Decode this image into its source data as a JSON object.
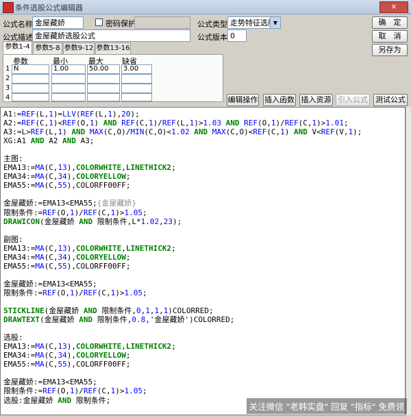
{
  "window": {
    "title": "条件选股公式编辑器",
    "close_label": "×"
  },
  "form": {
    "name_label": "公式名称",
    "name_value": "金屋藏娇",
    "password_label": "密码保护",
    "desc_label": "公式描述",
    "desc_value": "金屋藏娇选股公式",
    "type_label": "公式类型",
    "type_value": "走势特征选股",
    "version_label": "公式版本",
    "version_value": "0"
  },
  "buttons": {
    "ok": "确　定",
    "cancel": "取　消",
    "save_as": "另存为",
    "edit_op": "编辑操作",
    "insert_func": "插入函数",
    "insert_resource": "插入资源",
    "import_formula": "引入公式",
    "test_formula": "测试公式"
  },
  "tabs": [
    "参数1-4",
    "参数5-8",
    "参数9-12",
    "参数13-16"
  ],
  "params": {
    "headers": [
      "参数",
      "最小",
      "最大",
      "缺省"
    ],
    "rows": [
      {
        "num": "1",
        "name": "N",
        "min": "1.00",
        "max": "50.00",
        "default": "3.00"
      },
      {
        "num": "2",
        "name": "",
        "min": "",
        "max": "",
        "default": ""
      },
      {
        "num": "3",
        "name": "",
        "min": "",
        "max": "",
        "default": ""
      },
      {
        "num": "4",
        "name": "",
        "min": "",
        "max": "",
        "default": ""
      }
    ]
  },
  "code_lines": [
    [
      [
        "n",
        "A1:="
      ],
      [
        "f",
        "REF"
      ],
      [
        "n",
        "(L,"
      ],
      [
        "f",
        "1"
      ],
      [
        "n",
        ")="
      ],
      [
        "f",
        "LLV"
      ],
      [
        "n",
        "("
      ],
      [
        "f",
        "REF"
      ],
      [
        "n",
        "(L,"
      ],
      [
        "f",
        "1"
      ],
      [
        "n",
        "),"
      ],
      [
        "f",
        "20"
      ],
      [
        "n",
        ");"
      ]
    ],
    [
      [
        "n",
        "A2:="
      ],
      [
        "f",
        "REF"
      ],
      [
        "n",
        "(C,"
      ],
      [
        "f",
        "1"
      ],
      [
        "n",
        ")<"
      ],
      [
        "f",
        "REF"
      ],
      [
        "n",
        "(O,"
      ],
      [
        "f",
        "1"
      ],
      [
        "n",
        ") "
      ],
      [
        "k",
        "AND"
      ],
      [
        "n",
        " "
      ],
      [
        "f",
        "REF"
      ],
      [
        "n",
        "(C,"
      ],
      [
        "f",
        "1"
      ],
      [
        "n",
        ")/"
      ],
      [
        "f",
        "REF"
      ],
      [
        "n",
        "(L,"
      ],
      [
        "f",
        "1"
      ],
      [
        "n",
        ")>"
      ],
      [
        "f",
        "1.03"
      ],
      [
        "n",
        " "
      ],
      [
        "k",
        "AND"
      ],
      [
        "n",
        " "
      ],
      [
        "f",
        "REF"
      ],
      [
        "n",
        "(O,"
      ],
      [
        "f",
        "1"
      ],
      [
        "n",
        ")/"
      ],
      [
        "f",
        "REF"
      ],
      [
        "n",
        "(C,"
      ],
      [
        "f",
        "1"
      ],
      [
        "n",
        ")>"
      ],
      [
        "f",
        "1.01"
      ],
      [
        "n",
        ";"
      ]
    ],
    [
      [
        "n",
        "A3:=L>"
      ],
      [
        "f",
        "REF"
      ],
      [
        "n",
        "(L,"
      ],
      [
        "f",
        "1"
      ],
      [
        "n",
        ") "
      ],
      [
        "k",
        "AND"
      ],
      [
        "n",
        " "
      ],
      [
        "f",
        "MAX"
      ],
      [
        "n",
        "(C,O)/"
      ],
      [
        "f",
        "MIN"
      ],
      [
        "n",
        "(C,O)<"
      ],
      [
        "f",
        "1.02"
      ],
      [
        "n",
        " "
      ],
      [
        "k",
        "AND"
      ],
      [
        "n",
        " "
      ],
      [
        "f",
        "MAX"
      ],
      [
        "n",
        "(C,O)<"
      ],
      [
        "f",
        "REF"
      ],
      [
        "n",
        "(C,"
      ],
      [
        "f",
        "1"
      ],
      [
        "n",
        ") "
      ],
      [
        "k",
        "AND"
      ],
      [
        "n",
        " V<"
      ],
      [
        "f",
        "REF"
      ],
      [
        "n",
        "(V,"
      ],
      [
        "f",
        "1"
      ],
      [
        "n",
        ");"
      ]
    ],
    [
      [
        "n",
        "XG:A1 "
      ],
      [
        "k",
        "AND"
      ],
      [
        "n",
        " A2 "
      ],
      [
        "k",
        "AND"
      ],
      [
        "n",
        " A3;"
      ]
    ],
    [],
    [
      [
        "n",
        "主图:"
      ]
    ],
    [
      [
        "n",
        "EMA13:="
      ],
      [
        "f",
        "MA"
      ],
      [
        "n",
        "(C,"
      ],
      [
        "f",
        "13"
      ],
      [
        "n",
        "),"
      ],
      [
        "k",
        "COLORWHITE"
      ],
      [
        "n",
        ","
      ],
      [
        "k",
        "LINETHICK2"
      ],
      [
        "n",
        ";"
      ]
    ],
    [
      [
        "n",
        "EMA34:="
      ],
      [
        "f",
        "MA"
      ],
      [
        "n",
        "(C,"
      ],
      [
        "f",
        "34"
      ],
      [
        "n",
        "),"
      ],
      [
        "k",
        "COLORYELLOW"
      ],
      [
        "n",
        ";"
      ]
    ],
    [
      [
        "n",
        "EMA55:="
      ],
      [
        "f",
        "MA"
      ],
      [
        "n",
        "(C,"
      ],
      [
        "f",
        "55"
      ],
      [
        "n",
        "),COLORFF00FF;"
      ]
    ],
    [],
    [
      [
        "n",
        "金屋藏娇:=EMA13<EMA55;"
      ],
      [
        "c",
        "{金屋藏娇}"
      ]
    ],
    [
      [
        "n",
        "限制条件:="
      ],
      [
        "f",
        "REF"
      ],
      [
        "n",
        "(O,"
      ],
      [
        "f",
        "1"
      ],
      [
        "n",
        ")/"
      ],
      [
        "f",
        "REF"
      ],
      [
        "n",
        "(C,"
      ],
      [
        "f",
        "1"
      ],
      [
        "n",
        ")>"
      ],
      [
        "f",
        "1.05"
      ],
      [
        "n",
        ";"
      ]
    ],
    [
      [
        "k",
        "DRAWICON"
      ],
      [
        "n",
        "(金屋藏娇 "
      ],
      [
        "k",
        "AND"
      ],
      [
        "n",
        " 限制条件,L*"
      ],
      [
        "f",
        "1.02"
      ],
      [
        "n",
        ","
      ],
      [
        "f",
        "23"
      ],
      [
        "n",
        ");"
      ]
    ],
    [],
    [
      [
        "n",
        "副图:"
      ]
    ],
    [
      [
        "n",
        "EMA13:="
      ],
      [
        "f",
        "MA"
      ],
      [
        "n",
        "(C,"
      ],
      [
        "f",
        "13"
      ],
      [
        "n",
        "),"
      ],
      [
        "k",
        "COLORWHITE"
      ],
      [
        "n",
        ","
      ],
      [
        "k",
        "LINETHICK2"
      ],
      [
        "n",
        ";"
      ]
    ],
    [
      [
        "n",
        "EMA34:="
      ],
      [
        "f",
        "MA"
      ],
      [
        "n",
        "(C,"
      ],
      [
        "f",
        "34"
      ],
      [
        "n",
        "),"
      ],
      [
        "k",
        "COLORYELLOW"
      ],
      [
        "n",
        ";"
      ]
    ],
    [
      [
        "n",
        "EMA55:="
      ],
      [
        "f",
        "MA"
      ],
      [
        "n",
        "(C,"
      ],
      [
        "f",
        "55"
      ],
      [
        "n",
        "),COLORFF00FF;"
      ]
    ],
    [],
    [
      [
        "n",
        "金屋藏娇:=EMA13<EMA55;"
      ]
    ],
    [
      [
        "n",
        "限制条件:="
      ],
      [
        "f",
        "REF"
      ],
      [
        "n",
        "(O,"
      ],
      [
        "f",
        "1"
      ],
      [
        "n",
        ")/"
      ],
      [
        "f",
        "REF"
      ],
      [
        "n",
        "(C,"
      ],
      [
        "f",
        "1"
      ],
      [
        "n",
        ")>"
      ],
      [
        "f",
        "1.05"
      ],
      [
        "n",
        ";"
      ]
    ],
    [],
    [
      [
        "k",
        "STICKLINE"
      ],
      [
        "n",
        "(金屋藏娇 "
      ],
      [
        "k",
        "AND"
      ],
      [
        "n",
        " 限制条件,"
      ],
      [
        "f",
        "0"
      ],
      [
        "n",
        ","
      ],
      [
        "f",
        "1"
      ],
      [
        "n",
        ","
      ],
      [
        "f",
        "1"
      ],
      [
        "n",
        ","
      ],
      [
        "f",
        "1"
      ],
      [
        "n",
        ")COLORRED;"
      ]
    ],
    [
      [
        "k",
        "DRAWTEXT"
      ],
      [
        "n",
        "(金屋藏娇 "
      ],
      [
        "k",
        "AND"
      ],
      [
        "n",
        " 限制条件,"
      ],
      [
        "f",
        "0.8"
      ],
      [
        "n",
        ",'金屋藏娇')COLORRED;"
      ]
    ],
    [],
    [
      [
        "n",
        "选股:"
      ]
    ],
    [
      [
        "n",
        "EMA13:="
      ],
      [
        "f",
        "MA"
      ],
      [
        "n",
        "(C,"
      ],
      [
        "f",
        "13"
      ],
      [
        "n",
        "),"
      ],
      [
        "k",
        "COLORWHITE"
      ],
      [
        "n",
        ","
      ],
      [
        "k",
        "LINETHICK2"
      ],
      [
        "n",
        ";"
      ]
    ],
    [
      [
        "n",
        "EMA34:="
      ],
      [
        "f",
        "MA"
      ],
      [
        "n",
        "(C,"
      ],
      [
        "f",
        "34"
      ],
      [
        "n",
        "),"
      ],
      [
        "k",
        "COLORYELLOW"
      ],
      [
        "n",
        ";"
      ]
    ],
    [
      [
        "n",
        "EMA55:="
      ],
      [
        "f",
        "MA"
      ],
      [
        "n",
        "(C,"
      ],
      [
        "f",
        "55"
      ],
      [
        "n",
        "),COLORFF00FF;"
      ]
    ],
    [],
    [
      [
        "n",
        "金屋藏娇:=EMA13<EMA55;"
      ]
    ],
    [
      [
        "n",
        "限制条件:="
      ],
      [
        "f",
        "REF"
      ],
      [
        "n",
        "(O,"
      ],
      [
        "f",
        "1"
      ],
      [
        "n",
        ")/"
      ],
      [
        "f",
        "REF"
      ],
      [
        "n",
        "(C,"
      ],
      [
        "f",
        "1"
      ],
      [
        "n",
        ")>"
      ],
      [
        "f",
        "1.05"
      ],
      [
        "n",
        ";"
      ]
    ],
    [
      [
        "n",
        "选股:金屋藏娇 "
      ],
      [
        "k",
        "AND"
      ],
      [
        "n",
        " 限制条件;"
      ]
    ]
  ],
  "watermark": "关注微信 \"老韩实盘\" 回复 \"指标\" 免费领"
}
